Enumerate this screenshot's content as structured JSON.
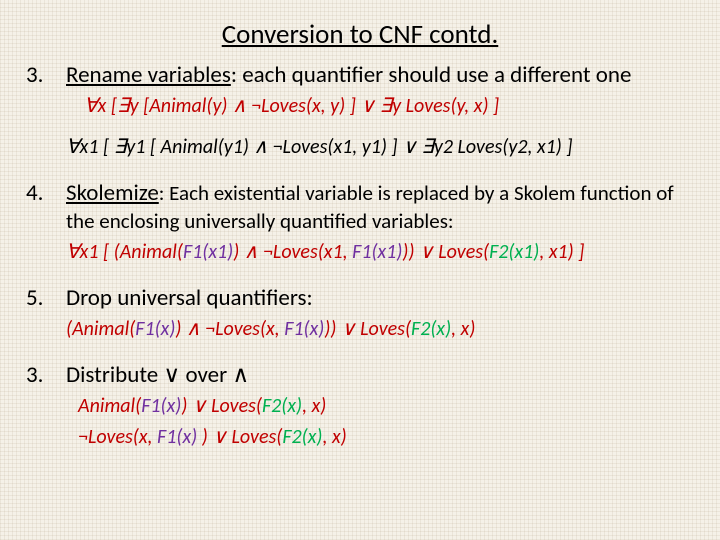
{
  "title": "Conversion to CNF contd.",
  "steps": [
    {
      "num": "3",
      "head": "Rename variables",
      "body": ": each quantifier should use a different one",
      "formula_a": "∀x [∃y [Animal(y) ∧ ¬Loves(x, y) ] ∨ ∃y Loves(y, x) ]",
      "formula_b": "∀x1 [ ∃y1 [ Animal(y1) ∧ ¬Loves(x1, y1) ] ∨ ∃y2 Loves(y2, x1) ]"
    },
    {
      "num": "4",
      "head": "Skolemize",
      "body": ": Each existential variable is replaced by a Skolem function of the enclosing universally quantified variables:",
      "formula_pre": "∀x1 [ (Animal(",
      "formula_f1": "F1(x1)",
      "formula_mid1": ") ∧ ¬Loves(x1, ",
      "formula_f1b": "F1(x1)",
      "formula_mid2": ")) ∨ Loves(",
      "formula_f2": "F2(x1)",
      "formula_post": ", x1) ]"
    },
    {
      "num": "5",
      "head": "Drop universal quantifiers",
      "body": ":",
      "formula_pre": "(Animal(",
      "formula_f1": "F1(x)",
      "formula_mid1": ") ∧ ¬Loves(x, ",
      "formula_f1b": "F1(x)",
      "formula_mid2": ")) ∨ Loves(",
      "formula_f2": "F2(x)",
      "formula_post": ", x)"
    },
    {
      "num": "3",
      "head": "Distribute ∨ over ∧",
      "line1_pre": "Animal(",
      "line1_f1": "F1(x)",
      "line1_mid": ") ∨ Loves(",
      "line1_f2": "F2(x)",
      "line1_post": ", x)",
      "line2_pre": "¬Loves(x, ",
      "line2_f1": "F1(x)",
      "line2_mid": " ) ∨ Loves(",
      "line2_f2": "F2(x)",
      "line2_post": ", x)"
    }
  ]
}
